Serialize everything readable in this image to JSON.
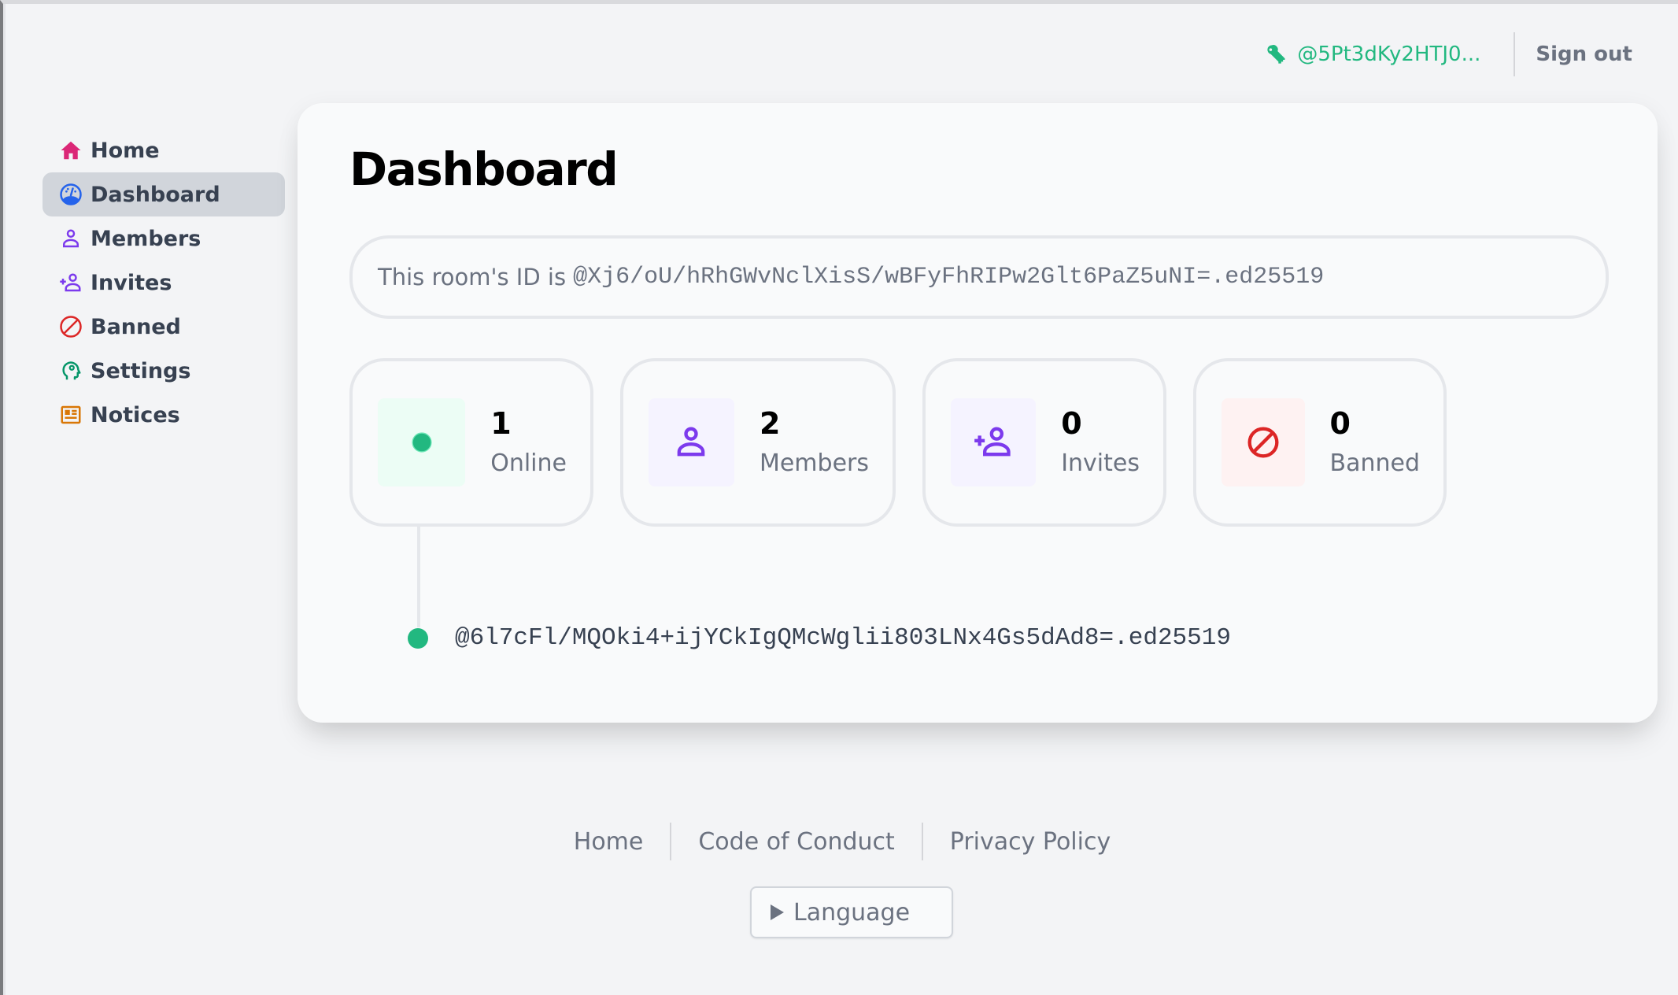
{
  "header": {
    "user_id": "@5Pt3dKy2HTJ0...",
    "user_icon": "key-icon",
    "signout_label": "Sign out"
  },
  "sidebar": {
    "items": [
      {
        "label": "Home",
        "icon": "home-icon",
        "color": "#db2777",
        "active": false
      },
      {
        "label": "Dashboard",
        "icon": "dashboard-gauge-icon",
        "color": "#2563eb",
        "active": true
      },
      {
        "label": "Members",
        "icon": "user-icon",
        "color": "#7c3aed",
        "active": false
      },
      {
        "label": "Invites",
        "icon": "user-plus-icon",
        "color": "#7c3aed",
        "active": false
      },
      {
        "label": "Banned",
        "icon": "ban-icon",
        "color": "#dc2626",
        "active": false
      },
      {
        "label": "Settings",
        "icon": "head-gear-icon",
        "color": "#059669",
        "active": false
      },
      {
        "label": "Notices",
        "icon": "newspaper-icon",
        "color": "#d97706",
        "active": false
      }
    ]
  },
  "main": {
    "title": "Dashboard",
    "room_id_prefix": "This room's ID is",
    "room_id": "@Xj6/oU/hRhGWvNclXisS/wBFyFhRIPw2Glt6PaZ5uNI=.ed25519",
    "stats": [
      {
        "value": "1",
        "label": "Online",
        "icon": "online-dot-icon",
        "color": "#22b880",
        "bg": "#ecfdf5"
      },
      {
        "value": "2",
        "label": "Members",
        "icon": "user-icon",
        "color": "#7c3aed",
        "bg": "#f5f3ff"
      },
      {
        "value": "0",
        "label": "Invites",
        "icon": "user-plus-icon",
        "color": "#7c3aed",
        "bg": "#f5f3ff"
      },
      {
        "value": "0",
        "label": "Banned",
        "icon": "ban-icon",
        "color": "#dc2626",
        "bg": "#fef2f2"
      }
    ],
    "online_members": [
      {
        "id": "@6l7cFl/MQOki4+ijYCkIgQMcWglii803LNx4Gs5dAd8=.ed25519"
      }
    ]
  },
  "footer": {
    "links": [
      "Home",
      "Code of Conduct",
      "Privacy Policy"
    ],
    "language_label": "Language"
  }
}
